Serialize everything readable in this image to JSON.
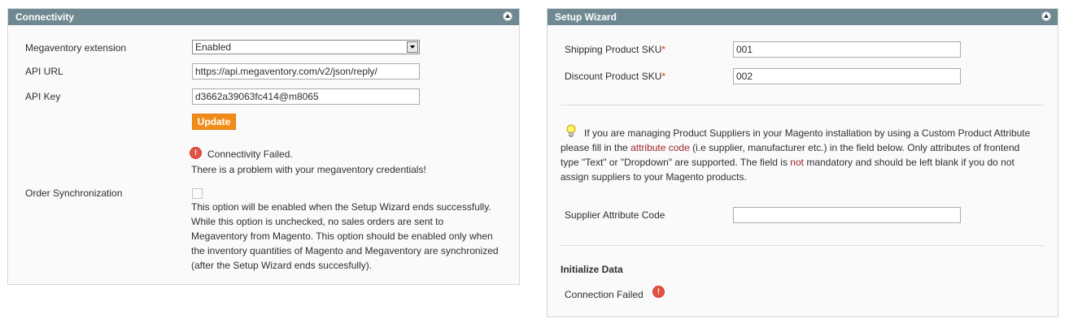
{
  "connectivity": {
    "title": "Connectivity",
    "extension_label": "Megaventory extension",
    "extension_value": "Enabled",
    "api_url_label": "API URL",
    "api_url_value": "https://api.megaventory.com/v2/json/reply/",
    "api_key_label": "API Key",
    "api_key_value": "d3662a39063fc414@m8065",
    "update_label": "Update",
    "error_title": "Connectivity Failed.",
    "error_detail": "There is a problem with your megaventory credentials!",
    "order_sync_label": "Order Synchronization",
    "order_sync_note": [
      "This option will be enabled when the Setup Wizard ends successfully.",
      "While this option is unchecked, no sales orders are sent to",
      "Megaventory from Magento. This option should be enabled only when",
      "the inventory quantities of Magento and Megaventory are synchronized",
      "(after the Setup Wizard ends succesfully)."
    ]
  },
  "setup_wizard": {
    "title": "Setup Wizard",
    "shipping_sku_label": "Shipping Product SKU",
    "shipping_sku_value": "001",
    "discount_sku_label": "Discount Product SKU",
    "discount_sku_value": "002",
    "required_mark": "*",
    "info": {
      "l1": "If you are managing Product Suppliers in your Magento installation by using a Custom Product Attribute",
      "l2_a": "please fill in the ",
      "l2_hl": "attribute code",
      "l2_b": " (i.e supplier, manufacturer etc.) in the field below. Only attributes of frontend",
      "l3_a": "type \"Text\" or \"Dropdown\" are supported. The field is ",
      "l3_hl": "not",
      "l3_b": " mandatory and should be left blank if you do not",
      "l4": "assign suppliers to your Magento products."
    },
    "supplier_attr_label": "Supplier Attribute Code",
    "supplier_attr_value": "",
    "init_title": "Initialize Data",
    "connection_status": "Connection Failed"
  },
  "icons": {
    "collapse": "collapse-up-icon",
    "error": "error-icon",
    "select_arrow": "chevron-down-icon",
    "hint": "lightbulb-icon"
  },
  "colors": {
    "header": "#6f8992",
    "button": "#f18c19",
    "error": "#e05446",
    "highlight": "#a1262e",
    "required": "#eb340a"
  }
}
